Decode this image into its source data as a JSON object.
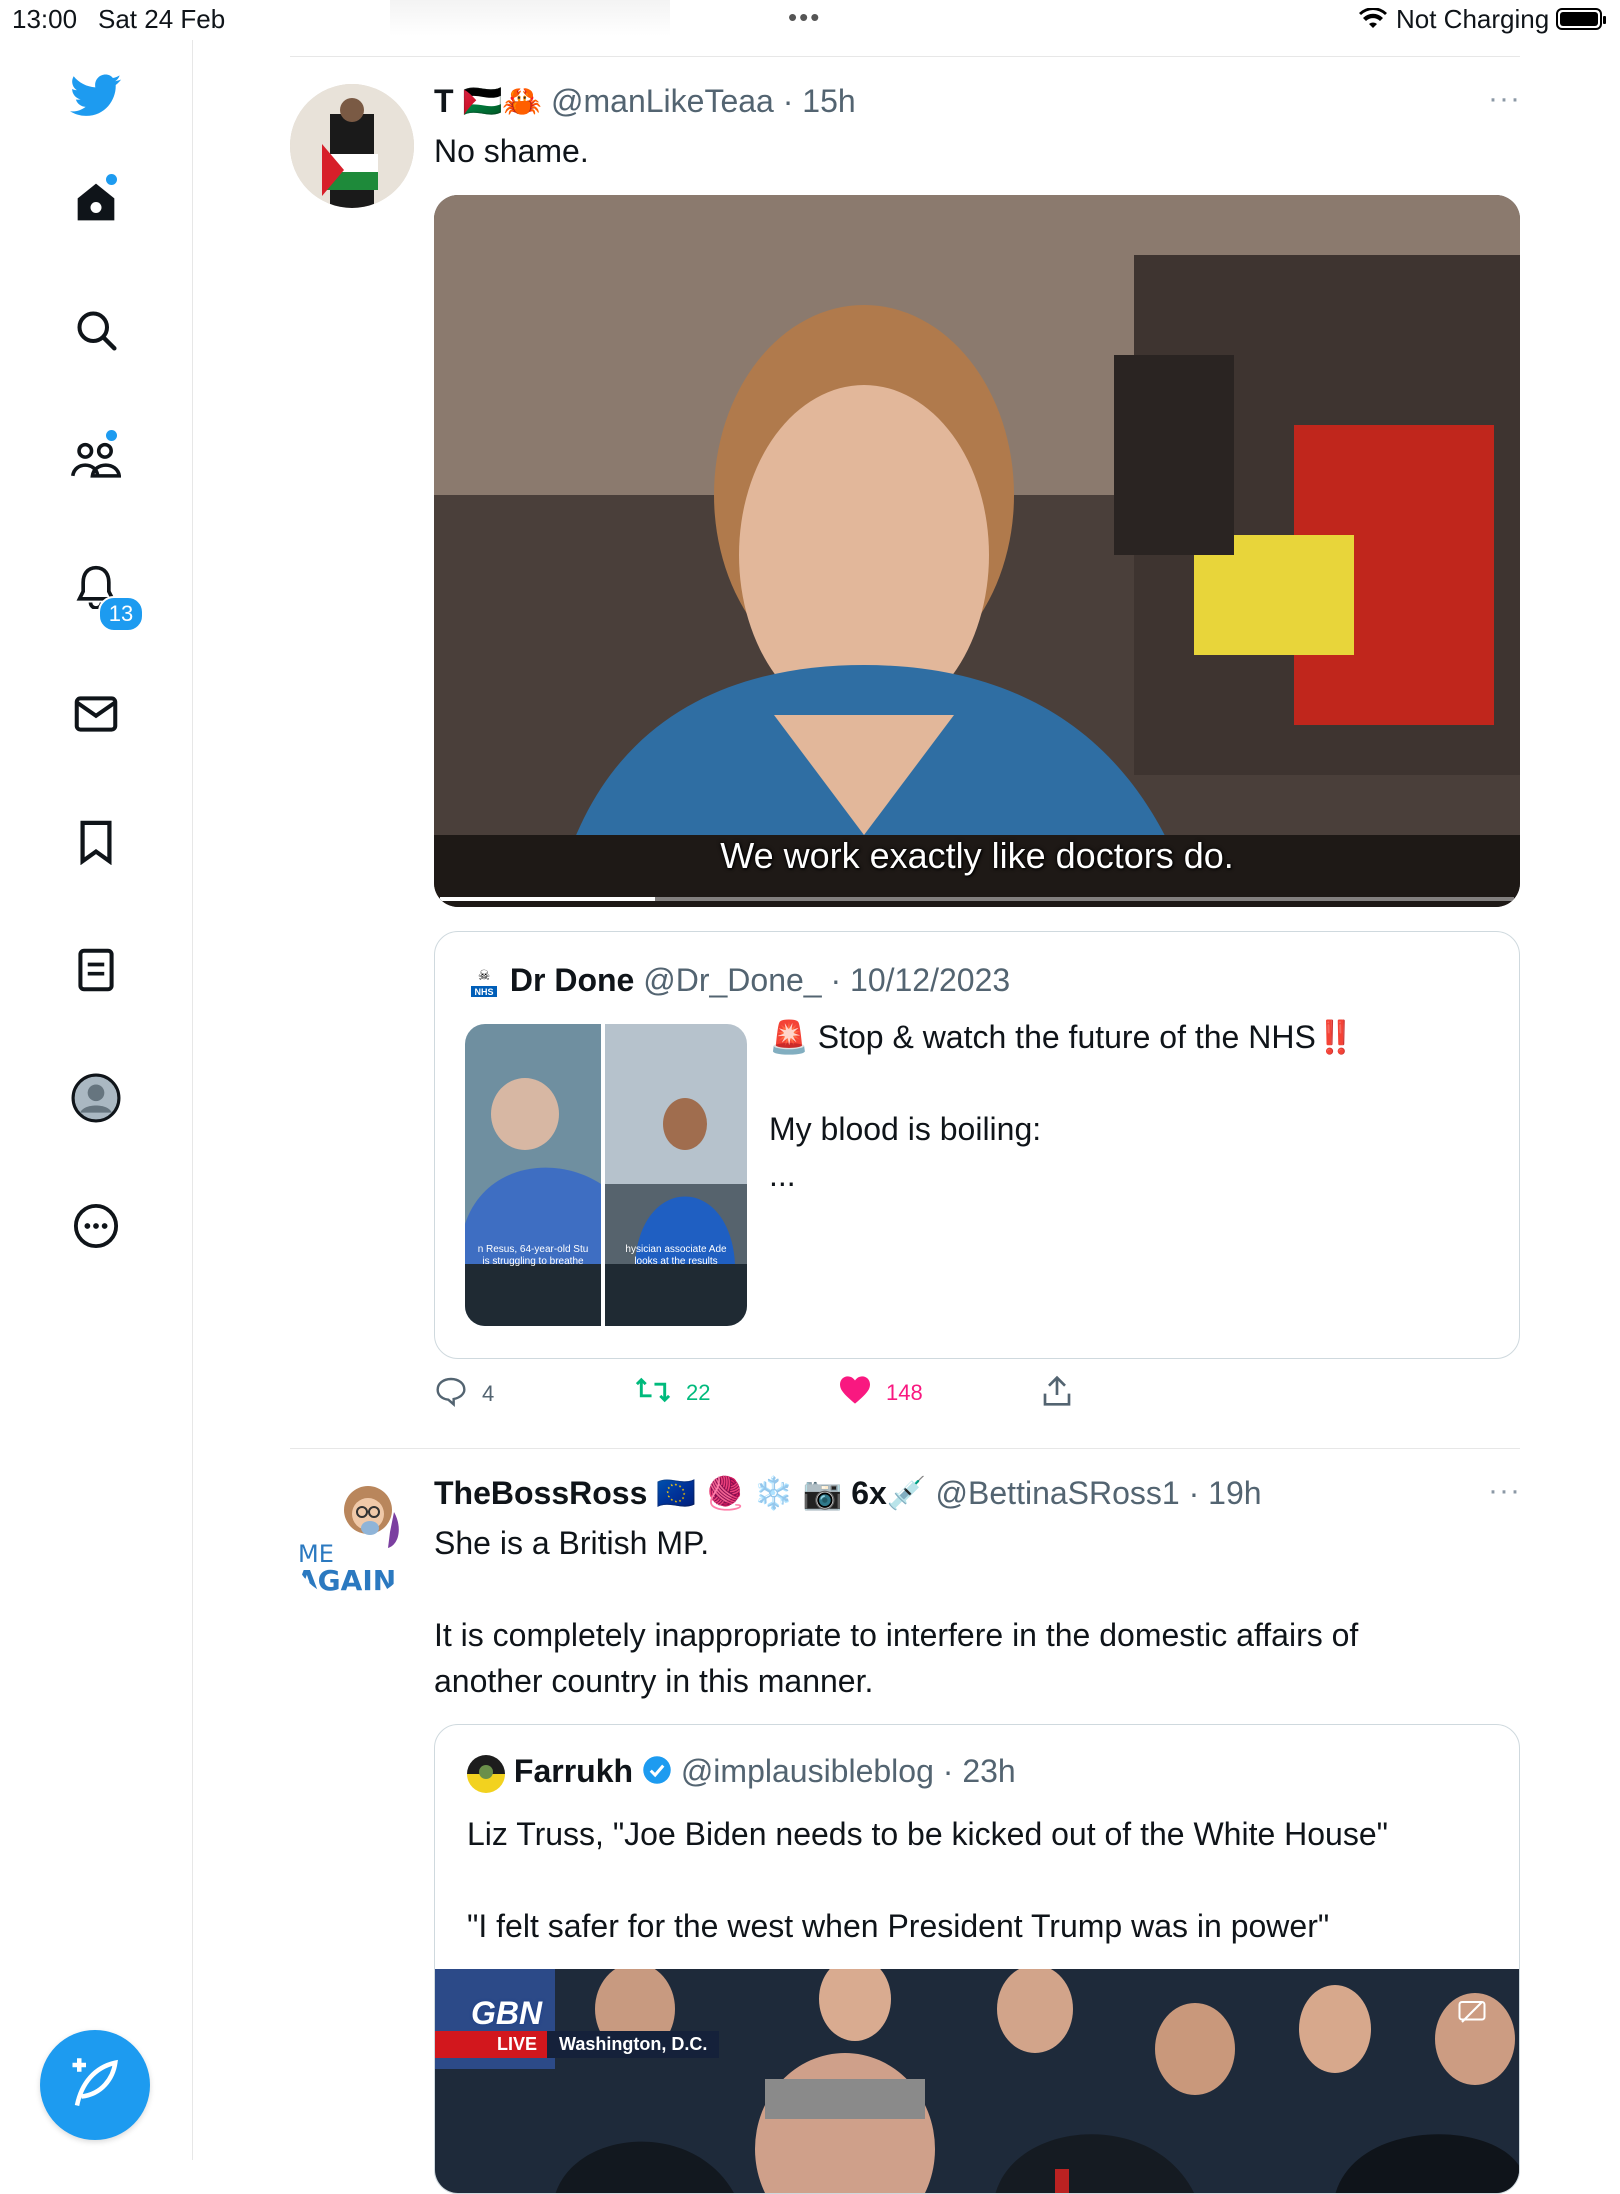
{
  "status_bar": {
    "time": "13:00",
    "date": "Sat 24 Feb",
    "multitask": "•••",
    "charging": "Not Charging"
  },
  "sidebar": {
    "items": [
      {
        "icon": "twitter-bird-icon"
      },
      {
        "icon": "home-icon"
      },
      {
        "icon": "search-icon"
      },
      {
        "icon": "communities-icon"
      },
      {
        "icon": "notifications-bell-icon",
        "badge": "13"
      },
      {
        "icon": "messages-envelope-icon"
      },
      {
        "icon": "bookmark-icon"
      },
      {
        "icon": "lists-icon"
      },
      {
        "icon": "profile-avatar-icon"
      },
      {
        "icon": "more-circle-icon"
      }
    ],
    "compose_icon": "compose-feather-icon"
  },
  "tweets": [
    {
      "name": "T 🇵🇸🦀",
      "handle": "@manLikeTeaa",
      "time": "· 15h",
      "more": "···",
      "text": "No shame.",
      "video_caption": "We work exactly like doctors do.",
      "quote": {
        "name": "Dr Done",
        "handle": "@Dr_Done_",
        "time": "· 10/12/2023",
        "text": "🚨 Stop & watch the future of the NHS‼️\n\nMy blood is boiling:\n...",
        "thumb1_caption": "n Resus, 64-year-old Stu\nis struggling to breathe",
        "thumb2_caption": "hysician associate Ade\nlooks at the results"
      },
      "actions": {
        "replies": "4",
        "retweets": "22",
        "likes": "148"
      },
      "colors": {
        "retweet": "#00ba7c",
        "like": "#f91880"
      }
    },
    {
      "name": "TheBossRoss 🇪🇺 🧶 ❄️ 📷 6x💉",
      "handle": "@BettinaSRoss1",
      "time": "· 19h",
      "more": "···",
      "avatar_text_1": "ME",
      "avatar_text_2": "AGAIN",
      "text": "She is a British MP.\n\nIt is completely inappropriate to interfere in the domestic affairs of\nanother country in this manner.",
      "quote": {
        "name": "Farrukh",
        "handle": "@implausibleblog",
        "time": "· 23h",
        "text": "Liz Truss, \"Joe Biden needs to be kicked out of the White House\"\n\n\"I felt safer for the west when President Trump was in power\"",
        "tv_logo": "GBN",
        "tv_live": "LIVE",
        "tv_location": "Washington, D.C."
      }
    }
  ],
  "accent_color": "#1d9bf0"
}
